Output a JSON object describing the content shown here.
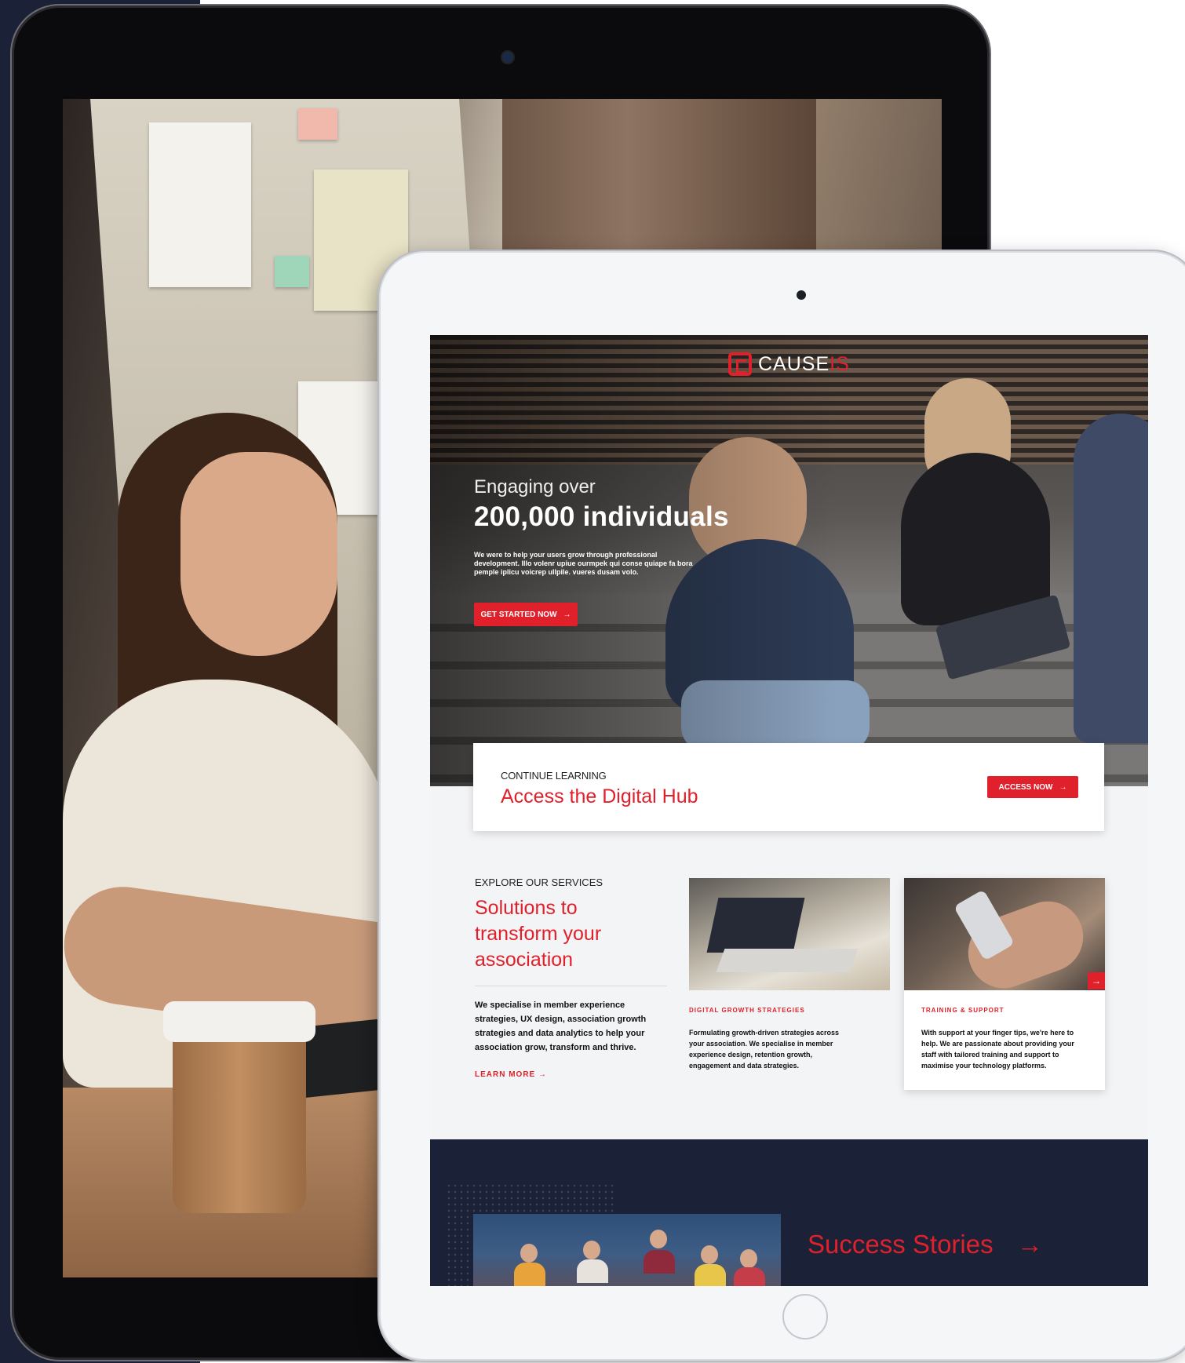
{
  "brand": {
    "logo_part1": "CAUSE",
    "logo_part2": "IS",
    "accent_color": "#e0202a",
    "navy_color": "#1b2237"
  },
  "hero": {
    "subtitle": "Engaging over",
    "title": "200,000 individuals",
    "body": "We were to help your users grow through professional development. Illo volenr upiue ourmpek qui conse quiape fa bora pemple iplicu voicrep ullpile. vueres dusam volo.",
    "cta_label": "GET STARTED NOW",
    "cta_icon": "arrow-right-icon"
  },
  "hub": {
    "eyebrow": "CONTINUE LEARNING",
    "title": "Access the Digital Hub",
    "cta_label": "ACCESS NOW",
    "cta_icon": "arrow-right-icon"
  },
  "services": {
    "eyebrow": "EXPLORE OUR SERVICES",
    "title": "Solutions to transform your association",
    "body": "We specialise in member experience strategies, UX design, association growth strategies and data analytics to help your association grow, transform and thrive.",
    "learn_more_label": "LEARN MORE →",
    "cards": [
      {
        "label": "DIGITAL GROWTH STRATEGIES",
        "text": "Formulating growth-driven strategies across your association. We specialise in member experience design, retention growth, engagement and data strategies."
      },
      {
        "label": "TRAINING & SUPPORT",
        "text": "With support at your finger tips, we're here to help. We are passionate about providing your staff with tailored training and support to maximise your technology platforms.",
        "arrow": "→"
      }
    ]
  },
  "stories": {
    "title": "Success Stories",
    "arrow": "→"
  }
}
